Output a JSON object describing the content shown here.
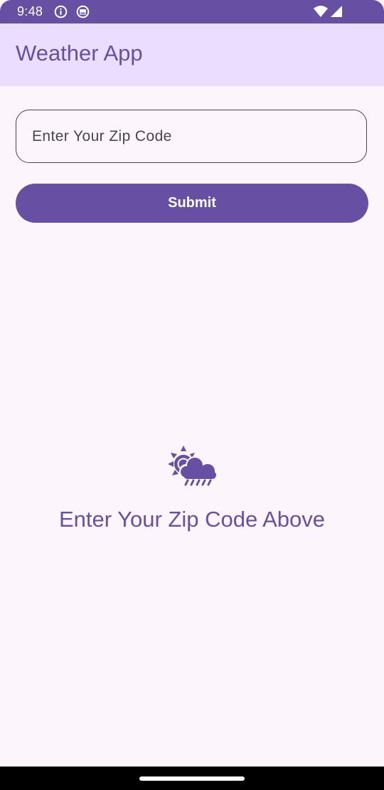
{
  "status_bar": {
    "time": "9:48",
    "left_icons": [
      "info-icon",
      "app-notification-icon"
    ],
    "right_icons": [
      "wifi-icon",
      "cellular-signal-icon"
    ]
  },
  "app_bar": {
    "title": "Weather App"
  },
  "form": {
    "zip_input": {
      "value": "",
      "placeholder": "Enter Your Zip Code"
    },
    "submit_label": "Submit"
  },
  "empty_state": {
    "icon": "weather-rain-sun-icon",
    "message": "Enter Your Zip Code Above"
  },
  "colors": {
    "primary": "#6750A4",
    "app_bar_background": "#EADDFF",
    "surface": "#FCF6FC",
    "outline": "#49454F"
  }
}
